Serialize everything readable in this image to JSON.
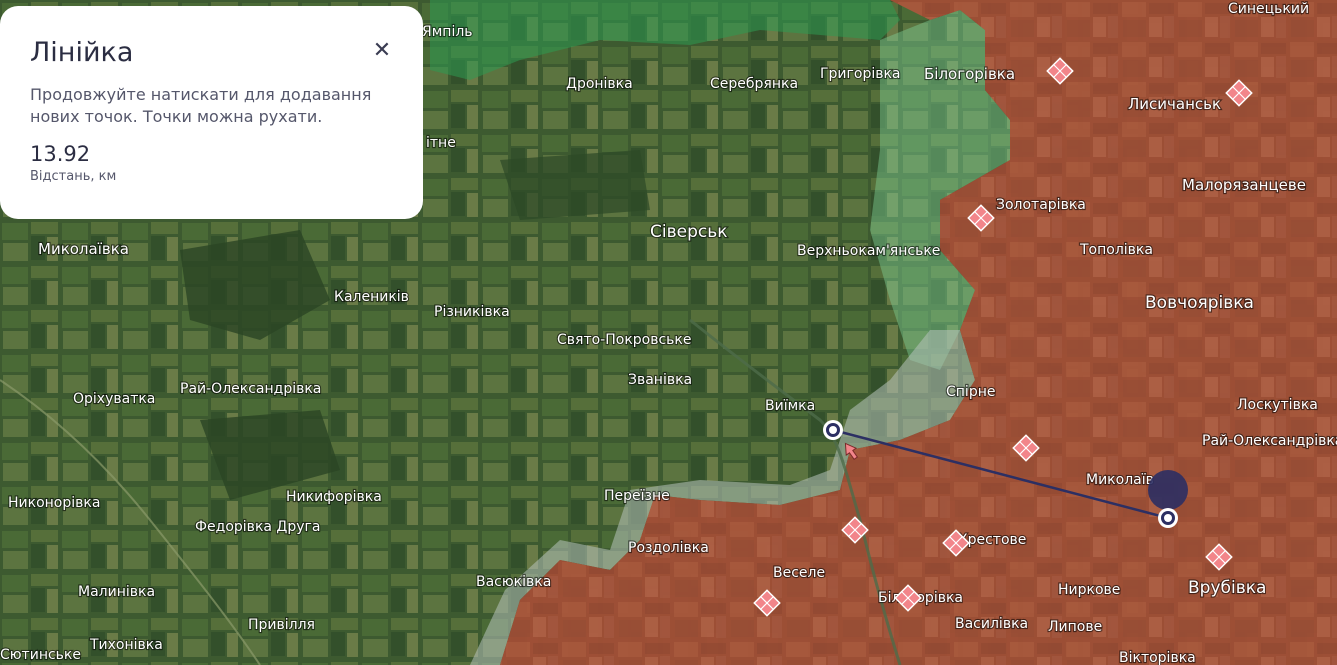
{
  "ruler": {
    "title": "Лінійка",
    "close_icon": "close-icon",
    "hint": "Продовжуйте натискати для додавання нових точок. Точки можна рухати.",
    "distance_value": "13.92",
    "distance_label": "Відстань, км"
  },
  "colors": {
    "occupied": "#a8533a",
    "contested": "#9aa7a0",
    "liberated": "#2e9a52",
    "ruler_line": "#2c2f63",
    "marker": "#f2858a",
    "panel_bg": "#ffffff"
  },
  "places": [
    {
      "name": "Ямпіль"
    },
    {
      "name": "Синецький"
    },
    {
      "name": "Дронівка"
    },
    {
      "name": "Серебрянка"
    },
    {
      "name": "Григорівка"
    },
    {
      "name": "Білогорівка"
    },
    {
      "name": "Лисичанськ"
    },
    {
      "name": "ітне"
    },
    {
      "name": "Малорязанцеве"
    },
    {
      "name": "Золотарівка"
    },
    {
      "name": "Сіверськ"
    },
    {
      "name": "Верхньокам'янське"
    },
    {
      "name": "Тополівка"
    },
    {
      "name": "Миколаївка"
    },
    {
      "name": "Вовчоярівка"
    },
    {
      "name": "Калеників"
    },
    {
      "name": "Різниківка"
    },
    {
      "name": "Свято-Покровське"
    },
    {
      "name": "Званівка"
    },
    {
      "name": "Спірне"
    },
    {
      "name": "Оріхуватка"
    },
    {
      "name": "Рай-Олександрівка"
    },
    {
      "name": "Виїмка"
    },
    {
      "name": "Лоскутівка"
    },
    {
      "name": "Рай-Олександрівка"
    },
    {
      "name": "Миколаїв"
    },
    {
      "name": "Никонорівка"
    },
    {
      "name": "Никифорівка"
    },
    {
      "name": "Переїзне"
    },
    {
      "name": "Федорівка Друга"
    },
    {
      "name": "Роздолівка"
    },
    {
      "name": "Хрестове"
    },
    {
      "name": "Веселе"
    },
    {
      "name": "Васюківка"
    },
    {
      "name": "Ниркове"
    },
    {
      "name": "Врубівка"
    },
    {
      "name": "Малинівка"
    },
    {
      "name": "Білогорівка"
    },
    {
      "name": "Привілля"
    },
    {
      "name": "Василівка"
    },
    {
      "name": "Липове"
    },
    {
      "name": "Тихонівка"
    },
    {
      "name": "Вікторівка"
    },
    {
      "name": "Сютинське"
    }
  ],
  "markers": [
    {
      "type": "diamond-marker"
    },
    {
      "type": "diamond-marker"
    },
    {
      "type": "diamond-marker"
    },
    {
      "type": "diamond-marker"
    },
    {
      "type": "diamond-marker"
    },
    {
      "type": "diamond-marker"
    },
    {
      "type": "diamond-marker"
    },
    {
      "type": "diamond-marker"
    },
    {
      "type": "diamond-marker"
    }
  ]
}
